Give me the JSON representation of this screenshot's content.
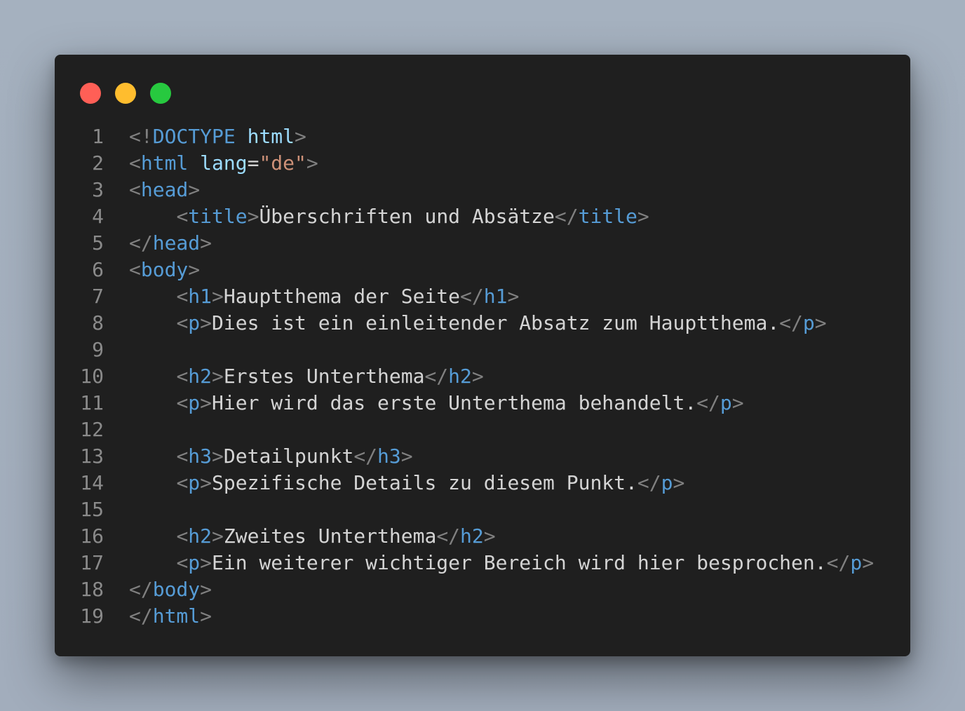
{
  "colors": {
    "background": "#a4b0be",
    "window": "#1f1f1f",
    "line_number": "#8a8a8a",
    "punctuation": "#808080",
    "tag": "#569cd6",
    "attribute": "#9cdcfe",
    "string": "#ce9178",
    "text": "#d4d4d4",
    "traffic_red": "#ff5f56",
    "traffic_yellow": "#ffbd2e",
    "traffic_green": "#27c93f"
  },
  "lines": [
    {
      "n": "1",
      "tokens": [
        [
          "p",
          "<!"
        ],
        [
          "t",
          "DOCTYPE"
        ],
        [
          "x",
          " "
        ],
        [
          "a",
          "html"
        ],
        [
          "p",
          ">"
        ]
      ]
    },
    {
      "n": "2",
      "tokens": [
        [
          "p",
          "<"
        ],
        [
          "t",
          "html"
        ],
        [
          "x",
          " "
        ],
        [
          "a",
          "lang"
        ],
        [
          "x",
          "="
        ],
        [
          "s",
          "\"de\""
        ],
        [
          "p",
          ">"
        ]
      ]
    },
    {
      "n": "3",
      "tokens": [
        [
          "p",
          "<"
        ],
        [
          "t",
          "head"
        ],
        [
          "p",
          ">"
        ]
      ]
    },
    {
      "n": "4",
      "tokens": [
        [
          "x",
          "    "
        ],
        [
          "p",
          "<"
        ],
        [
          "t",
          "title"
        ],
        [
          "p",
          ">"
        ],
        [
          "x",
          "Überschriften und Absätze"
        ],
        [
          "p",
          "</"
        ],
        [
          "t",
          "title"
        ],
        [
          "p",
          ">"
        ]
      ]
    },
    {
      "n": "5",
      "tokens": [
        [
          "p",
          "</"
        ],
        [
          "t",
          "head"
        ],
        [
          "p",
          ">"
        ]
      ]
    },
    {
      "n": "6",
      "tokens": [
        [
          "p",
          "<"
        ],
        [
          "t",
          "body"
        ],
        [
          "p",
          ">"
        ]
      ]
    },
    {
      "n": "7",
      "tokens": [
        [
          "x",
          "    "
        ],
        [
          "p",
          "<"
        ],
        [
          "t",
          "h1"
        ],
        [
          "p",
          ">"
        ],
        [
          "x",
          "Hauptthema der Seite"
        ],
        [
          "p",
          "</"
        ],
        [
          "t",
          "h1"
        ],
        [
          "p",
          ">"
        ]
      ]
    },
    {
      "n": "8",
      "tokens": [
        [
          "x",
          "    "
        ],
        [
          "p",
          "<"
        ],
        [
          "t",
          "p"
        ],
        [
          "p",
          ">"
        ],
        [
          "x",
          "Dies ist ein einleitender Absatz zum Hauptthema."
        ],
        [
          "p",
          "</"
        ],
        [
          "t",
          "p"
        ],
        [
          "p",
          ">"
        ]
      ]
    },
    {
      "n": "9",
      "tokens": []
    },
    {
      "n": "10",
      "tokens": [
        [
          "x",
          "    "
        ],
        [
          "p",
          "<"
        ],
        [
          "t",
          "h2"
        ],
        [
          "p",
          ">"
        ],
        [
          "x",
          "Erstes Unterthema"
        ],
        [
          "p",
          "</"
        ],
        [
          "t",
          "h2"
        ],
        [
          "p",
          ">"
        ]
      ]
    },
    {
      "n": "11",
      "tokens": [
        [
          "x",
          "    "
        ],
        [
          "p",
          "<"
        ],
        [
          "t",
          "p"
        ],
        [
          "p",
          ">"
        ],
        [
          "x",
          "Hier wird das erste Unterthema behandelt."
        ],
        [
          "p",
          "</"
        ],
        [
          "t",
          "p"
        ],
        [
          "p",
          ">"
        ]
      ]
    },
    {
      "n": "12",
      "tokens": []
    },
    {
      "n": "13",
      "tokens": [
        [
          "x",
          "    "
        ],
        [
          "p",
          "<"
        ],
        [
          "t",
          "h3"
        ],
        [
          "p",
          ">"
        ],
        [
          "x",
          "Detailpunkt"
        ],
        [
          "p",
          "</"
        ],
        [
          "t",
          "h3"
        ],
        [
          "p",
          ">"
        ]
      ]
    },
    {
      "n": "14",
      "tokens": [
        [
          "x",
          "    "
        ],
        [
          "p",
          "<"
        ],
        [
          "t",
          "p"
        ],
        [
          "p",
          ">"
        ],
        [
          "x",
          "Spezifische Details zu diesem Punkt."
        ],
        [
          "p",
          "</"
        ],
        [
          "t",
          "p"
        ],
        [
          "p",
          ">"
        ]
      ]
    },
    {
      "n": "15",
      "tokens": []
    },
    {
      "n": "16",
      "tokens": [
        [
          "x",
          "    "
        ],
        [
          "p",
          "<"
        ],
        [
          "t",
          "h2"
        ],
        [
          "p",
          ">"
        ],
        [
          "x",
          "Zweites Unterthema"
        ],
        [
          "p",
          "</"
        ],
        [
          "t",
          "h2"
        ],
        [
          "p",
          ">"
        ]
      ]
    },
    {
      "n": "17",
      "tokens": [
        [
          "x",
          "    "
        ],
        [
          "p",
          "<"
        ],
        [
          "t",
          "p"
        ],
        [
          "p",
          ">"
        ],
        [
          "x",
          "Ein weiterer wichtiger Bereich wird hier besprochen."
        ],
        [
          "p",
          "</"
        ],
        [
          "t",
          "p"
        ],
        [
          "p",
          ">"
        ]
      ]
    },
    {
      "n": "18",
      "tokens": [
        [
          "p",
          "</"
        ],
        [
          "t",
          "body"
        ],
        [
          "p",
          ">"
        ]
      ]
    },
    {
      "n": "19",
      "tokens": [
        [
          "p",
          "</"
        ],
        [
          "t",
          "html"
        ],
        [
          "p",
          ">"
        ]
      ]
    }
  ]
}
